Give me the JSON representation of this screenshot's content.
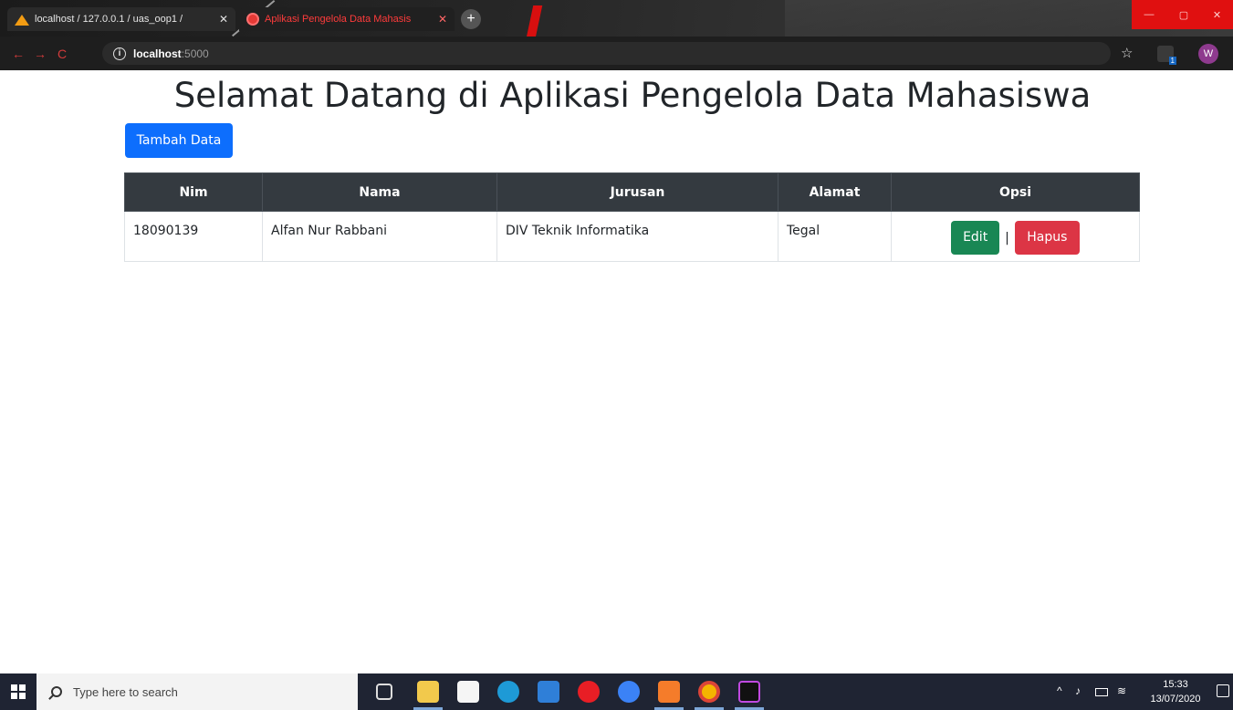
{
  "browser": {
    "tabs": [
      {
        "title": "localhost / 127.0.0.1 / uas_oop1 / ",
        "close": "✕",
        "icon": "phpmyadmin-icon"
      },
      {
        "title": "Aplikasi Pengelola Data Mahasis",
        "close": "✕",
        "icon": "globe-icon"
      }
    ],
    "new_tab": "+",
    "address": {
      "host": "localhost",
      "port": ":5000"
    },
    "avatar_initial": "W",
    "nav": {
      "back": "←",
      "forward": "→",
      "reload": "C"
    },
    "star": "☆",
    "window": {
      "minimize": "—",
      "maximize": "▢",
      "close": "✕"
    }
  },
  "page": {
    "title": "Selamat Datang di Aplikasi Pengelola Data Mahasiswa",
    "add_button": "Tambah Data",
    "table": {
      "headers": [
        "Nim",
        "Nama",
        "Jurusan",
        "Alamat",
        "Opsi"
      ],
      "rows": [
        {
          "nim": "18090139",
          "nama": "Alfan Nur Rabbani",
          "jurusan": "DIV Teknik Informatika",
          "alamat": "Tegal",
          "edit": "Edit",
          "separator": "|",
          "hapus": "Hapus"
        }
      ]
    },
    "colors": {
      "primary": "#0d6efd",
      "success": "#198754",
      "danger": "#dc3545",
      "table_header": "#343a40"
    }
  },
  "taskbar": {
    "search_placeholder": "Type here to search",
    "time": "15:33",
    "date": "13/07/2020",
    "apps": [
      "task-view-icon",
      "file-explorer-icon",
      "store-icon",
      "edge-icon",
      "mail-icon",
      "opera-icon",
      "app-icon",
      "xampp-icon",
      "chrome-icon",
      "intellij-icon"
    ]
  }
}
